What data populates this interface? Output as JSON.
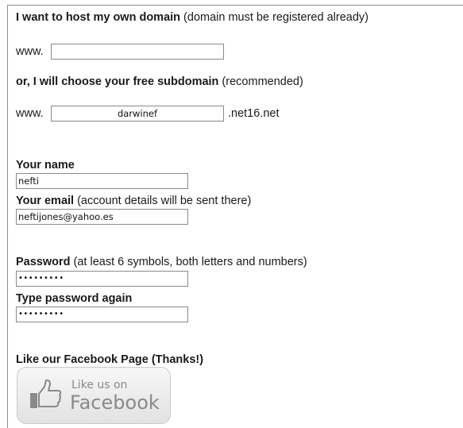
{
  "own_domain": {
    "heading_bold": "I want to host my own domain",
    "heading_note": " (domain must be registered already)",
    "prefix": "www.",
    "value": ""
  },
  "subdomain": {
    "heading_bold": "or, I will choose your free subdomain",
    "heading_note": " (recommended)",
    "prefix": "www.",
    "value": "darwinef",
    "suffix": ".net16.net"
  },
  "name": {
    "label": "Your name",
    "value": "nefti"
  },
  "email": {
    "label_bold": "Your email",
    "label_note": " (account details will be sent there)",
    "value": "neftijones@yahoo.es"
  },
  "password": {
    "label_bold": "Password",
    "label_note": " (at least 6 symbols, both letters and numbers)",
    "value": "•••••••••"
  },
  "password_again": {
    "label": "Type password again",
    "value": "•••••••••"
  },
  "facebook": {
    "heading": "Like our Facebook Page (Thanks!)",
    "button_small": "Like us on",
    "button_big": "Facebook",
    "icon": "thumbs-up-icon"
  }
}
